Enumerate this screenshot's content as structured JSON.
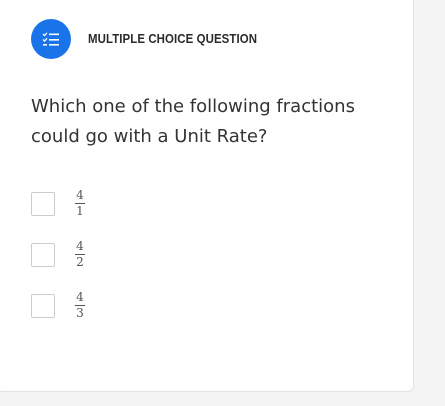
{
  "question_type": {
    "label": "MULTIPLE CHOICE QUESTION",
    "icon": "list-check-icon",
    "icon_bg_color": "#1a73e8"
  },
  "question": {
    "text": "Which one of the following fractions could go with a Unit Rate?"
  },
  "options": [
    {
      "numerator": "4",
      "denominator": "1",
      "checked": false
    },
    {
      "numerator": "4",
      "denominator": "2",
      "checked": false
    },
    {
      "numerator": "4",
      "denominator": "3",
      "checked": false
    }
  ]
}
